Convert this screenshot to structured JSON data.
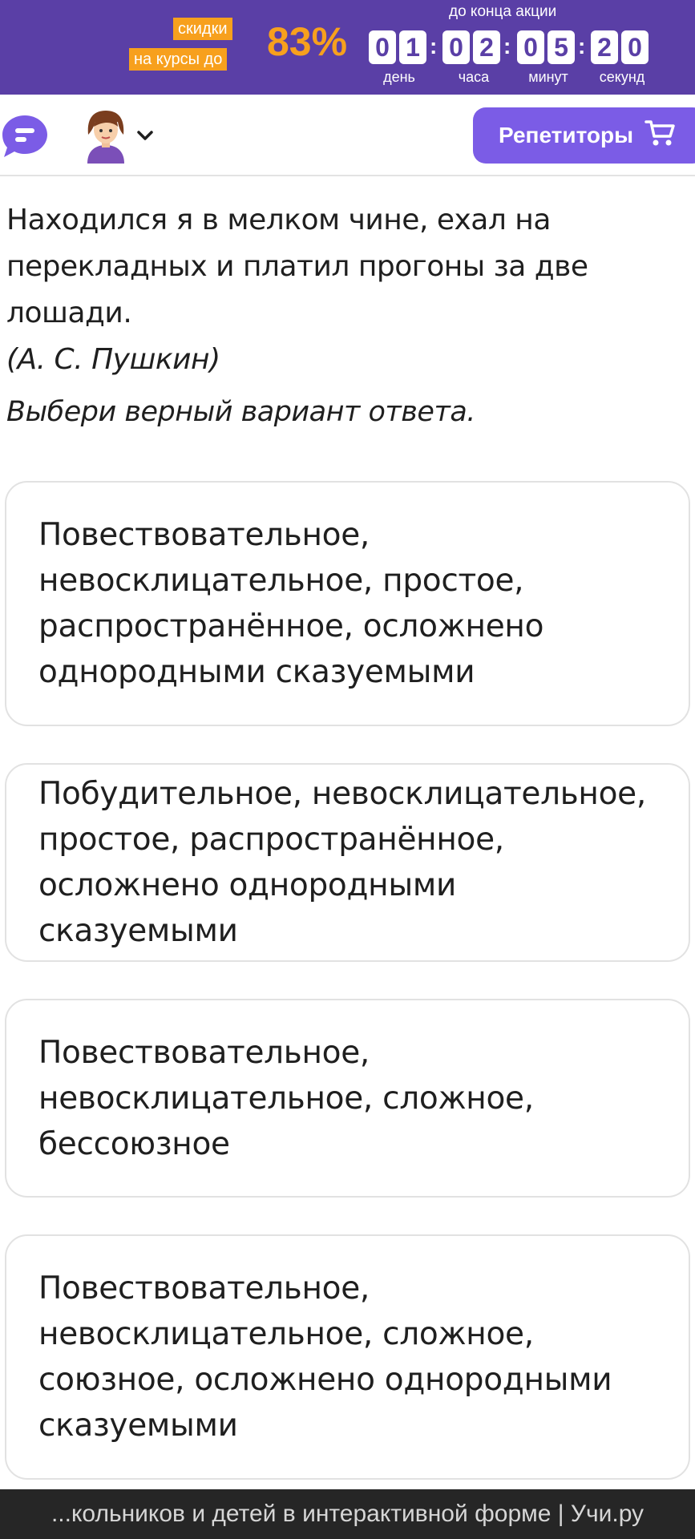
{
  "promo": {
    "label_top": "скидки",
    "label_bottom": "на курсы до",
    "percent": "83%",
    "deadline_title": "до конца акции",
    "timer": {
      "digits": [
        "0",
        "1",
        "0",
        "2",
        "0",
        "5",
        "2",
        "0"
      ],
      "units": [
        "день",
        "часа",
        "минут",
        "секунд"
      ]
    }
  },
  "header": {
    "tutors_button": "Репетиторы",
    "icons": [
      "chat-icon",
      "avatar-icon",
      "chevron-down-icon",
      "cart-icon"
    ]
  },
  "task": {
    "sentence": "Находился я в мелком чине, ехал на перекладных и платил прогоны за две лошади.",
    "author": "(А. С. Пушкин)",
    "instruction": "Выбери верный вариант ответа.",
    "options": [
      "Повествовательное, невосклицательное, простое, распространённое, осложнено однородными сказуемыми",
      "Побудительное, невосклицательное, простое, распространённое, осложнено однородными сказуемыми",
      "Повествовательное, невосклицательное, сложное, бессоюзное",
      "Повествовательное, невосклицательное, сложное, союзное, осложнено однородными сказуемыми"
    ]
  },
  "footer": {
    "page_title": "...кольников и детей в интерактивной форме | Учи.ру"
  },
  "colors": {
    "banner": "#5a3fa6",
    "accent_orange": "#f7a01d",
    "button": "#7b5ce6"
  }
}
